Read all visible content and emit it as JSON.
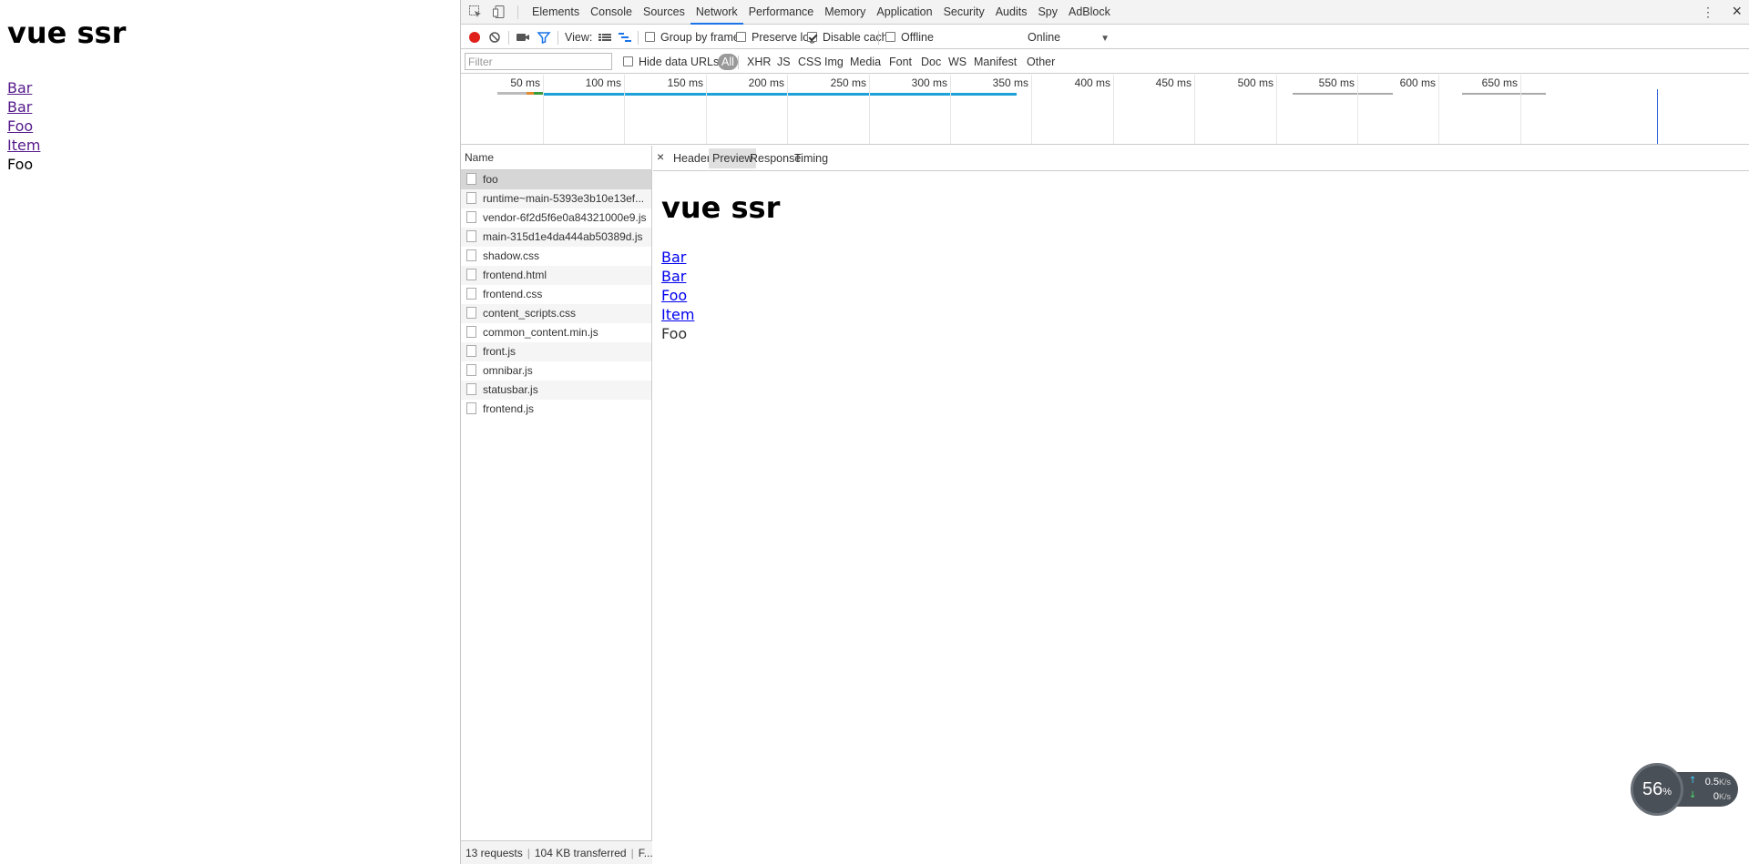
{
  "page": {
    "title": "vue ssr",
    "links": [
      "Bar",
      "Bar",
      "Foo",
      "Item"
    ],
    "current": "Foo"
  },
  "devtools": {
    "tabs": [
      "Elements",
      "Console",
      "Sources",
      "Network",
      "Performance",
      "Memory",
      "Application",
      "Security",
      "Audits",
      "Spy",
      "AdBlock"
    ],
    "active_tab": "Network",
    "toolbar": {
      "view_label": "View:",
      "group_by_frame": "Group by frame",
      "preserve_log": "Preserve log",
      "disable_cache": "Disable cache",
      "offline": "Offline",
      "throttle": "Online"
    },
    "filter": {
      "placeholder": "Filter",
      "hide_data_urls": "Hide data URLs",
      "types": [
        "All",
        "XHR",
        "JS",
        "CSS",
        "Img",
        "Media",
        "Font",
        "Doc",
        "WS",
        "Manifest",
        "Other"
      ]
    },
    "overview_ticks": [
      "50 ms",
      "100 ms",
      "150 ms",
      "200 ms",
      "250 ms",
      "300 ms",
      "350 ms",
      "400 ms",
      "450 ms",
      "500 ms",
      "550 ms",
      "600 ms",
      "650 ms"
    ],
    "requests": {
      "header": "Name",
      "items": [
        "foo",
        "runtime~main-5393e3b10e13ef...",
        "vendor-6f2d5f6e0a84321000e9.js",
        "main-315d1e4da444ab50389d.js",
        "shadow.css",
        "frontend.html",
        "frontend.css",
        "content_scripts.css",
        "common_content.min.js",
        "front.js",
        "omnibar.js",
        "statusbar.js",
        "frontend.js"
      ],
      "selected": "foo"
    },
    "status": {
      "requests": "13 requests",
      "transferred": "104 KB transferred",
      "finish": "F..."
    },
    "detail_tabs": [
      "Headers",
      "Preview",
      "Response",
      "Timing"
    ],
    "active_detail_tab": "Preview",
    "preview": {
      "title": "vue ssr",
      "links": [
        "Bar",
        "Bar",
        "Foo",
        "Item"
      ],
      "current": "Foo"
    }
  },
  "speed_widget": {
    "percent": "56",
    "percent_unit": "%",
    "upload": "0.5",
    "upload_unit": "K/s",
    "download": "0",
    "download_unit": "K/s"
  }
}
